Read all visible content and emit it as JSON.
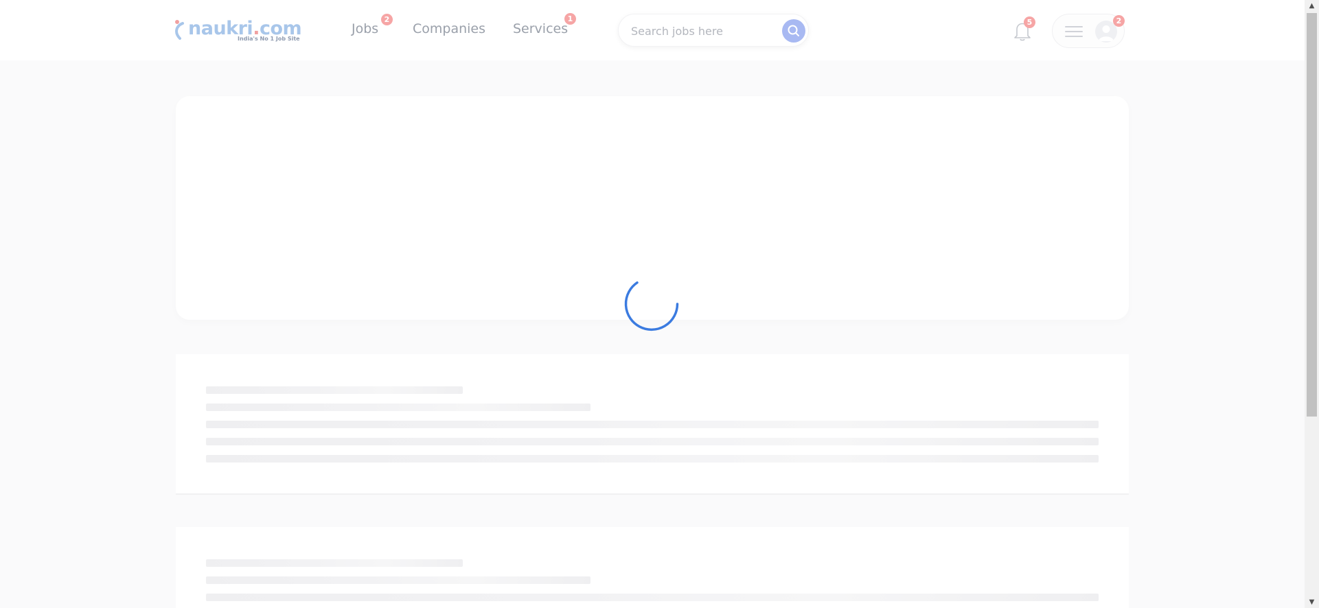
{
  "header": {
    "logo_text": "naukri",
    "logo_dot": ".",
    "logo_suffix": "com",
    "logo_tagline": "India's No 1 Job Site",
    "nav": [
      {
        "label": "Jobs",
        "badge": "2"
      },
      {
        "label": "Companies"
      },
      {
        "label": "Services",
        "badge": "1"
      }
    ],
    "search": {
      "placeholder": "Search jobs here",
      "icon": "search-icon"
    },
    "notifications": {
      "icon": "bell-icon",
      "badge": "5"
    },
    "profile": {
      "menu_icon": "hamburger-icon",
      "avatar_icon": "user-avatar-icon",
      "badge": "2"
    }
  },
  "loading": {
    "icon": "spinner-icon"
  },
  "colors": {
    "brand_blue": "#a8c6ea",
    "badge_red": "#f6a5a5",
    "search_button": "#a8b9f2",
    "spinner": "#3b7be0"
  }
}
